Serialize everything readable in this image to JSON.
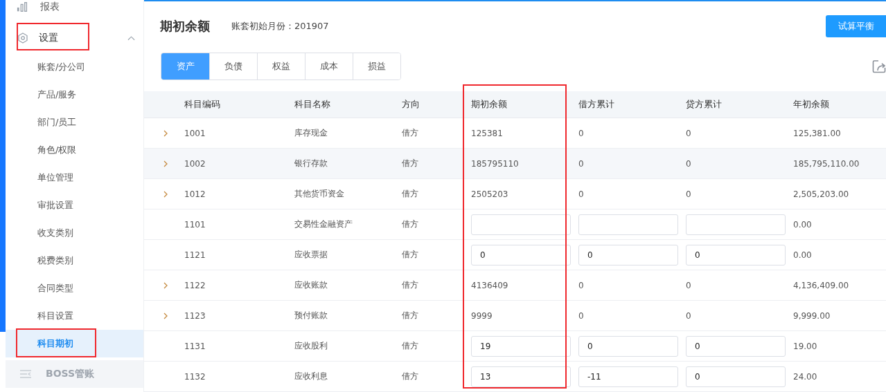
{
  "sidebar": {
    "top_item": {
      "label": "报表"
    },
    "section": {
      "label": "设置",
      "expanded": true,
      "highlighted": true
    },
    "items": [
      {
        "label": "账套/分公司",
        "selected": false,
        "highlighted": false
      },
      {
        "label": "产品/服务",
        "selected": false,
        "highlighted": false
      },
      {
        "label": "部门/员工",
        "selected": false,
        "highlighted": false
      },
      {
        "label": "角色/权限",
        "selected": false,
        "highlighted": false
      },
      {
        "label": "单位管理",
        "selected": false,
        "highlighted": false
      },
      {
        "label": "审批设置",
        "selected": false,
        "highlighted": false
      },
      {
        "label": "收支类别",
        "selected": false,
        "highlighted": false
      },
      {
        "label": "税费类别",
        "selected": false,
        "highlighted": false
      },
      {
        "label": "合同类型",
        "selected": false,
        "highlighted": false
      },
      {
        "label": "科目设置",
        "selected": false,
        "highlighted": false
      },
      {
        "label": "科目期初",
        "selected": true,
        "highlighted": true
      }
    ],
    "bottom_item": {
      "label": "BOSS管账",
      "disabled": true
    }
  },
  "page": {
    "title": "期初余额",
    "subtitle": "账套初始月份：201907",
    "button": "试算平衡"
  },
  "tabs": [
    {
      "label": "资产",
      "selected": true
    },
    {
      "label": "负债",
      "selected": false
    },
    {
      "label": "权益",
      "selected": false
    },
    {
      "label": "成本",
      "selected": false
    },
    {
      "label": "损益",
      "selected": false
    }
  ],
  "table": {
    "columns": [
      {
        "label": "科目编码",
        "highlighted": false
      },
      {
        "label": "科目名称",
        "highlighted": false
      },
      {
        "label": "方向",
        "highlighted": false
      },
      {
        "label": "期初余额",
        "highlighted": true
      },
      {
        "label": "借方累计",
        "highlighted": false
      },
      {
        "label": "贷方累计",
        "highlighted": false
      },
      {
        "label": "年初余额",
        "highlighted": false
      }
    ],
    "rows": [
      {
        "expandable": true,
        "hovered": false,
        "editable": false,
        "code": "1001",
        "name": "库存现金",
        "direction": "借方",
        "opening": "125381",
        "debit": "0",
        "credit": "0",
        "year_start": "125,381.00"
      },
      {
        "expandable": true,
        "hovered": true,
        "editable": false,
        "code": "1002",
        "name": "银行存款",
        "direction": "借方",
        "opening": "185795110",
        "debit": "0",
        "credit": "0",
        "year_start": "185,795,110.00"
      },
      {
        "expandable": true,
        "hovered": false,
        "editable": false,
        "code": "1012",
        "name": "其他货币资金",
        "direction": "借方",
        "opening": "2505203",
        "debit": "0",
        "credit": "0",
        "year_start": "2,505,203.00"
      },
      {
        "expandable": false,
        "hovered": false,
        "editable": true,
        "code": "1101",
        "name": "交易性金融资产",
        "direction": "借方",
        "year_start": "0.00"
      },
      {
        "expandable": false,
        "hovered": false,
        "editable": true,
        "code": "1121",
        "name": "应收票据",
        "direction": "借方",
        "opening": "0",
        "debit": "0",
        "credit": "0",
        "year_start": "0.00"
      },
      {
        "expandable": true,
        "hovered": false,
        "editable": false,
        "code": "1122",
        "name": "应收账款",
        "direction": "借方",
        "opening": "4136409",
        "debit": "0",
        "credit": "0",
        "year_start": "4,136,409.00"
      },
      {
        "expandable": true,
        "hovered": false,
        "editable": false,
        "code": "1123",
        "name": "预付账款",
        "direction": "借方",
        "opening": "9999",
        "debit": "0",
        "credit": "0",
        "year_start": "9,999.00"
      },
      {
        "expandable": false,
        "hovered": false,
        "editable": true,
        "code": "1131",
        "name": "应收股利",
        "direction": "借方",
        "opening": "19",
        "debit": "0",
        "credit": "0",
        "year_start": "19.00"
      },
      {
        "expandable": false,
        "hovered": false,
        "editable": true,
        "code": "1132",
        "name": "应收利息",
        "direction": "借方",
        "opening": "13",
        "debit": "-11",
        "credit": "0",
        "year_start": "24.00"
      }
    ]
  }
}
